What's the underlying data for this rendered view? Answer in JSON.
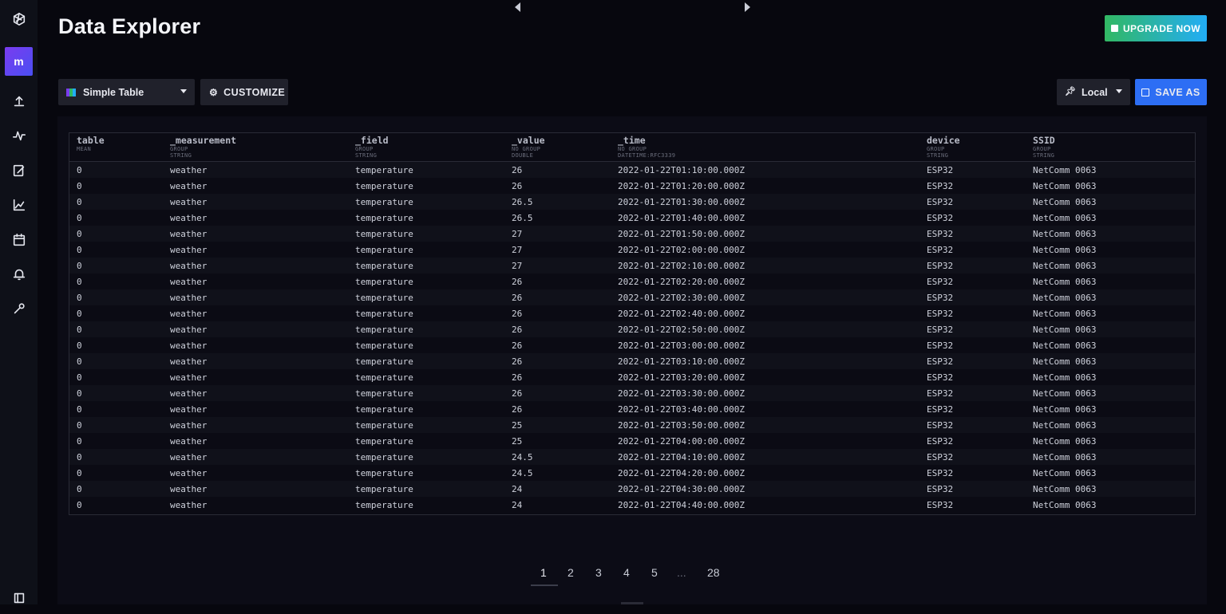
{
  "header": {
    "title": "Data Explorer",
    "upgrade_label": "UPGRADE NOW"
  },
  "sidebar": {
    "org_initial": "m",
    "icons": [
      "logo-icon",
      "upload-icon",
      "data-icon",
      "notebook-icon",
      "dashboard-icon",
      "tasks-icon",
      "alerts-icon",
      "settings-icon",
      "collapse-icon"
    ]
  },
  "toolbar": {
    "viz_type": "Simple Table",
    "customize_label": "CUSTOMIZE",
    "timezone": "Local",
    "save_as_label": "SAVE AS"
  },
  "table": {
    "columns": [
      {
        "name": "table",
        "meta1": "MEAN",
        "meta2": ""
      },
      {
        "name": "_measurement",
        "meta1": "GROUP",
        "meta2": "STRING"
      },
      {
        "name": "_field",
        "meta1": "GROUP",
        "meta2": "STRING"
      },
      {
        "name": "_value",
        "meta1": "NO GROUP",
        "meta2": "DOUBLE"
      },
      {
        "name": "_time",
        "meta1": "NO GROUP",
        "meta2": "DATETIME:RFC3339"
      },
      {
        "name": "device",
        "meta1": "GROUP",
        "meta2": "STRING"
      },
      {
        "name": "SSID",
        "meta1": "GROUP",
        "meta2": "STRING"
      }
    ],
    "rows": [
      [
        "0",
        "weather",
        "temperature",
        "26",
        "2022-01-22T01:10:00.000Z",
        "ESP32",
        "NetComm 0063"
      ],
      [
        "0",
        "weather",
        "temperature",
        "26",
        "2022-01-22T01:20:00.000Z",
        "ESP32",
        "NetComm 0063"
      ],
      [
        "0",
        "weather",
        "temperature",
        "26.5",
        "2022-01-22T01:30:00.000Z",
        "ESP32",
        "NetComm 0063"
      ],
      [
        "0",
        "weather",
        "temperature",
        "26.5",
        "2022-01-22T01:40:00.000Z",
        "ESP32",
        "NetComm 0063"
      ],
      [
        "0",
        "weather",
        "temperature",
        "27",
        "2022-01-22T01:50:00.000Z",
        "ESP32",
        "NetComm 0063"
      ],
      [
        "0",
        "weather",
        "temperature",
        "27",
        "2022-01-22T02:00:00.000Z",
        "ESP32",
        "NetComm 0063"
      ],
      [
        "0",
        "weather",
        "temperature",
        "27",
        "2022-01-22T02:10:00.000Z",
        "ESP32",
        "NetComm 0063"
      ],
      [
        "0",
        "weather",
        "temperature",
        "26",
        "2022-01-22T02:20:00.000Z",
        "ESP32",
        "NetComm 0063"
      ],
      [
        "0",
        "weather",
        "temperature",
        "26",
        "2022-01-22T02:30:00.000Z",
        "ESP32",
        "NetComm 0063"
      ],
      [
        "0",
        "weather",
        "temperature",
        "26",
        "2022-01-22T02:40:00.000Z",
        "ESP32",
        "NetComm 0063"
      ],
      [
        "0",
        "weather",
        "temperature",
        "26",
        "2022-01-22T02:50:00.000Z",
        "ESP32",
        "NetComm 0063"
      ],
      [
        "0",
        "weather",
        "temperature",
        "26",
        "2022-01-22T03:00:00.000Z",
        "ESP32",
        "NetComm 0063"
      ],
      [
        "0",
        "weather",
        "temperature",
        "26",
        "2022-01-22T03:10:00.000Z",
        "ESP32",
        "NetComm 0063"
      ],
      [
        "0",
        "weather",
        "temperature",
        "26",
        "2022-01-22T03:20:00.000Z",
        "ESP32",
        "NetComm 0063"
      ],
      [
        "0",
        "weather",
        "temperature",
        "26",
        "2022-01-22T03:30:00.000Z",
        "ESP32",
        "NetComm 0063"
      ],
      [
        "0",
        "weather",
        "temperature",
        "26",
        "2022-01-22T03:40:00.000Z",
        "ESP32",
        "NetComm 0063"
      ],
      [
        "0",
        "weather",
        "temperature",
        "25",
        "2022-01-22T03:50:00.000Z",
        "ESP32",
        "NetComm 0063"
      ],
      [
        "0",
        "weather",
        "temperature",
        "25",
        "2022-01-22T04:00:00.000Z",
        "ESP32",
        "NetComm 0063"
      ],
      [
        "0",
        "weather",
        "temperature",
        "24.5",
        "2022-01-22T04:10:00.000Z",
        "ESP32",
        "NetComm 0063"
      ],
      [
        "0",
        "weather",
        "temperature",
        "24.5",
        "2022-01-22T04:20:00.000Z",
        "ESP32",
        "NetComm 0063"
      ],
      [
        "0",
        "weather",
        "temperature",
        "24",
        "2022-01-22T04:30:00.000Z",
        "ESP32",
        "NetComm 0063"
      ],
      [
        "0",
        "weather",
        "temperature",
        "24",
        "2022-01-22T04:40:00.000Z",
        "ESP32",
        "NetComm 0063"
      ]
    ]
  },
  "pagination": {
    "pages": [
      "1",
      "2",
      "3",
      "4",
      "5",
      "...",
      "28"
    ],
    "current": "1"
  },
  "colors": {
    "accent_upgrade_start": "#32b863",
    "accent_upgrade_end": "#22adf6",
    "save_as": "#2d6ef4",
    "org_badge": "#6a45f0"
  }
}
